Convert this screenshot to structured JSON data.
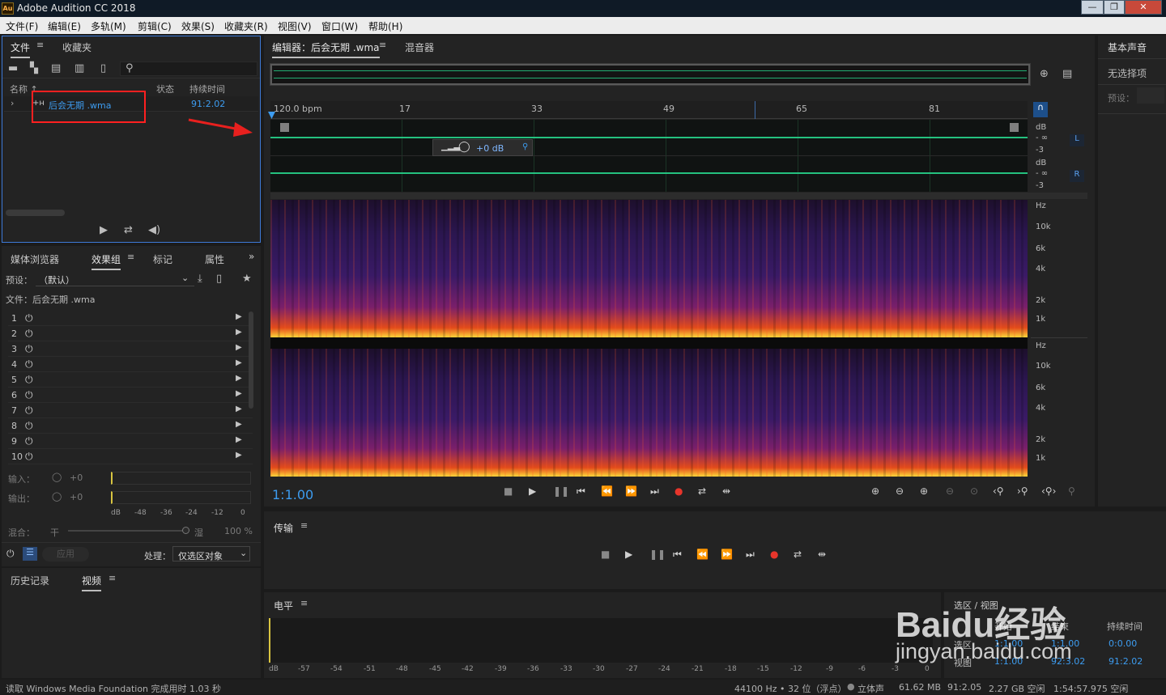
{
  "app": {
    "title": "Adobe Audition CC 2018",
    "logo": "Au"
  },
  "window_buttons": [
    "—",
    "❐",
    "✕"
  ],
  "menu": [
    "文件(F)",
    "编辑(E)",
    "多轨(M)",
    "剪辑(C)",
    "效果(S)",
    "收藏夹(R)",
    "视图(V)",
    "窗口(W)",
    "帮助(H)"
  ],
  "files_panel": {
    "tabs": [
      "文件",
      "收藏夹"
    ],
    "columns": {
      "name": "名称 ↑",
      "status": "状态",
      "duration": "持续时间"
    },
    "file": {
      "name": "后会无期 .wma",
      "duration": "91:2.02"
    }
  },
  "effects_panel": {
    "tabs": [
      "媒体浏览器",
      "效果组",
      "标记",
      "属性"
    ],
    "preset_label": "预设：",
    "preset_value": "（默认）",
    "file_label": "文件：后会无期 .wma",
    "slots": [
      "1",
      "2",
      "3",
      "4",
      "5",
      "6",
      "7",
      "8",
      "9",
      "10"
    ],
    "input_label": "输入：",
    "output_label": "输出：",
    "gain": "+0",
    "scale": [
      "dB",
      "-48",
      "-36",
      "-24",
      "-12",
      "0"
    ],
    "mix_label": "混合：",
    "mix_dry": "干",
    "mix_wet": "湿",
    "mix_pct": "100 %",
    "apply": "应用",
    "process_label": "处理：",
    "process_value": "仅选区对象"
  },
  "history_panel": {
    "tabs": [
      "历史记录",
      "视频"
    ]
  },
  "editor": {
    "tabs": [
      "编辑器：后会无期 .wma",
      "混音器"
    ],
    "ruler": [
      "120.0 bpm",
      "17",
      "33",
      "49",
      "65",
      "81"
    ],
    "hud_gain": "+0 dB",
    "db_labels": [
      "dB",
      "- ∞",
      "-3"
    ],
    "channels": [
      "L",
      "R"
    ],
    "hz_labels": [
      "Hz",
      "10k",
      "6k",
      "4k",
      "2k",
      "1k"
    ],
    "time_display": "1:1.00"
  },
  "right_panel": {
    "title": "基本声音",
    "subtitle": "无选择项",
    "preset": "预设："
  },
  "transport_panel": {
    "title": "传输"
  },
  "level_panel": {
    "title": "电平",
    "scale": [
      "dB",
      "-57",
      "-54",
      "-51",
      "-48",
      "-45",
      "-42",
      "-39",
      "-36",
      "-33",
      "-30",
      "-27",
      "-24",
      "-21",
      "-18",
      "-15",
      "-12",
      "-9",
      "-6",
      "-3",
      "0"
    ]
  },
  "selection_panel": {
    "title": "选区 / 视图",
    "headers": [
      "开始",
      "结束",
      "持续时间"
    ],
    "rows": [
      {
        "label": "选区",
        "start": "1:1.00",
        "end": "1:1.00",
        "duration": "0:0.00"
      },
      {
        "label": "视图",
        "start": "1:1.00",
        "end": "92:3.02",
        "duration": "91:2.02"
      }
    ]
  },
  "watermark": {
    "brand": "Baidu经验",
    "url": "jingyan.baidu.com"
  },
  "status_bar": {
    "message": "读取 Windows Media Foundation 完成用时 1.03 秒",
    "sample_info": "44100 Hz • 32 位（浮点）",
    "channels": "立体声",
    "size": "61.62 MB",
    "duration": "91:2.05",
    "free_space": "2.27 GB 空闲",
    "free_time": "1:54:57.975 空闲"
  },
  "colors": {
    "accent": "#3d9cf0",
    "waveform": "#27d58c",
    "highlight_box": "#ff2020",
    "record": "#e8352b"
  }
}
